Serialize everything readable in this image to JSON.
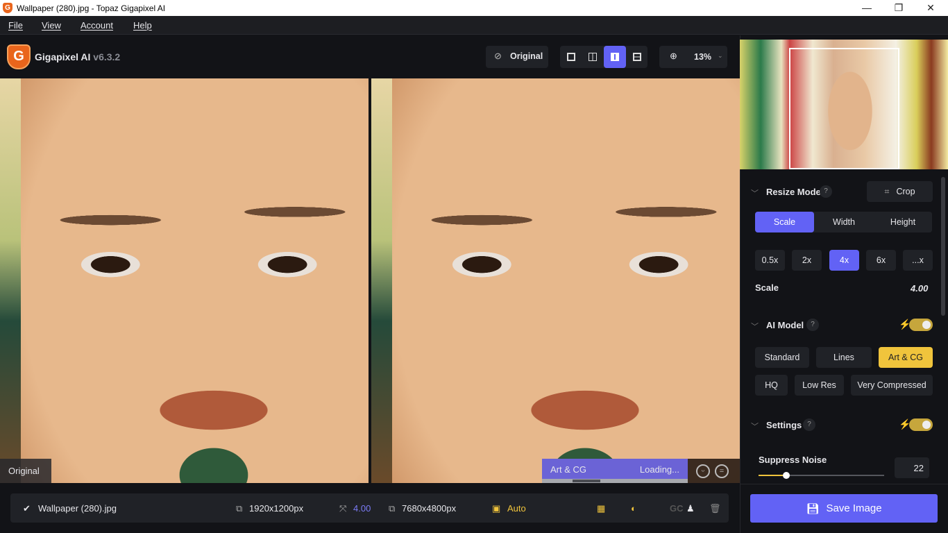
{
  "window": {
    "title": "Wallpaper (280).jpg - Topaz Gigapixel AI",
    "minimize": "—",
    "maximize": "❐",
    "close": "✕"
  },
  "menu": [
    "File",
    "View",
    "Account",
    "Help"
  ],
  "header": {
    "app_name": "Gigapixel AI",
    "version": "v6.3.2",
    "logo_letter": "G",
    "original_label": "Original",
    "view_modes": [
      "single",
      "split-vertical",
      "side-by-side",
      "grid"
    ],
    "active_view": "side-by-side",
    "zoom": "13%"
  },
  "preview": {
    "left_label": "Original",
    "model_label": "Art & CG",
    "status": "Loading..."
  },
  "file": {
    "name": "Wallpaper (280).jpg",
    "input_size": "1920x1200px",
    "scale": "4.00",
    "output_size": "7680x4800px",
    "auto_label": "Auto",
    "gc_label": "GC"
  },
  "panel": {
    "resize": {
      "title": "Resize Mode",
      "help": "?",
      "crop": "Crop",
      "modes": [
        "Scale",
        "Width",
        "Height"
      ],
      "active_mode": "Scale",
      "presets": [
        "0.5x",
        "2x",
        "4x",
        "6x",
        "...x"
      ],
      "active_preset": "4x",
      "scale_label": "Scale",
      "scale_value": "4.00"
    },
    "ai_model": {
      "title": "AI Model",
      "help": "?",
      "enabled": true,
      "models": [
        "Standard",
        "Lines",
        "Art & CG",
        "HQ",
        "Low Res",
        "Very Compressed"
      ],
      "active": "Art & CG"
    },
    "settings": {
      "title": "Settings",
      "help": "?",
      "enabled": true,
      "suppress_noise_label": "Suppress Noise",
      "suppress_noise": "22",
      "suppress_noise_fraction": 0.22
    },
    "save": "Save Image"
  },
  "colors": {
    "accent": "#6262f5",
    "gold": "#f0c43c",
    "brand": "#e9651c"
  }
}
